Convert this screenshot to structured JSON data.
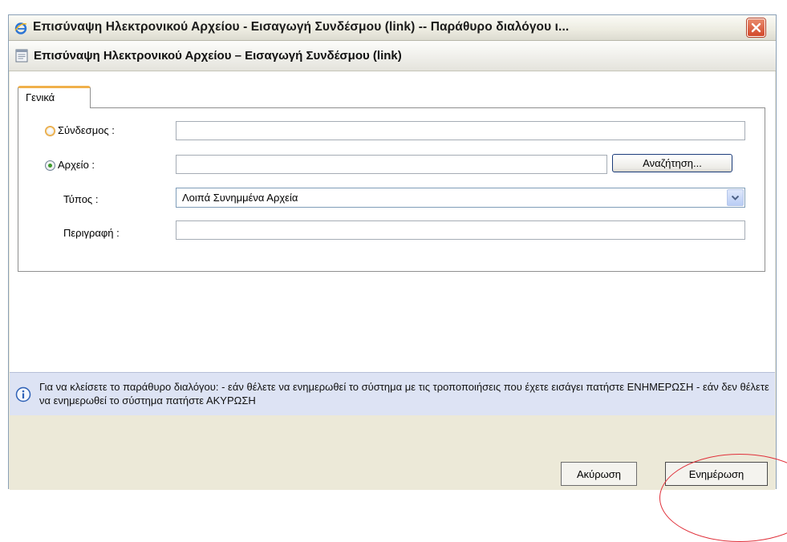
{
  "window": {
    "title": "Επισύναψη Ηλεκτρονικού Αρχείου - Εισαγωγή Συνδέσμου (link) -- Παράθυρο διαλόγου ι...",
    "header_title": "Επισύναψη Ηλεκτρονικού Αρχείου – Εισαγωγή Συνδέσμου (link)"
  },
  "tabs": [
    {
      "label": "Γενικά",
      "active": true
    }
  ],
  "form": {
    "link_label": "Σύνδεσμος :",
    "link_value": "",
    "file_label": "Αρχείο :",
    "file_value": "",
    "browse_label": "Αναζήτηση...",
    "type_label": "Τύπος :",
    "type_value": "Λοιπά Συνημμένα Αρχεία",
    "description_label": "Περιγραφή :",
    "description_value": "",
    "selected_option": "file"
  },
  "info": {
    "text": "Για να κλείσετε το παράθυρο διαλόγου: - εάν θέλετε να ενημερωθεί το σύστημα με τις τροποποιήσεις που έχετε εισάγει πατήστε ΕΝΗΜΕΡΩΣΗ - εάν δεν θέλετε να ενημερωθεί το σύστημα πατήστε ΑΚΥΡΩΣΗ"
  },
  "buttons": {
    "cancel": "Ακύρωση",
    "update": "Ενημέρωση"
  },
  "icons": {
    "title": "internet-explorer-icon",
    "close": "close-icon",
    "header": "document-icon",
    "info": "info-icon",
    "dropdown": "chevron-down-icon"
  },
  "colors": {
    "tab_accent": "#f0b04b",
    "info_background": "#dde3f4",
    "close_button": "#d2482a",
    "annotation": "#e0303a"
  }
}
